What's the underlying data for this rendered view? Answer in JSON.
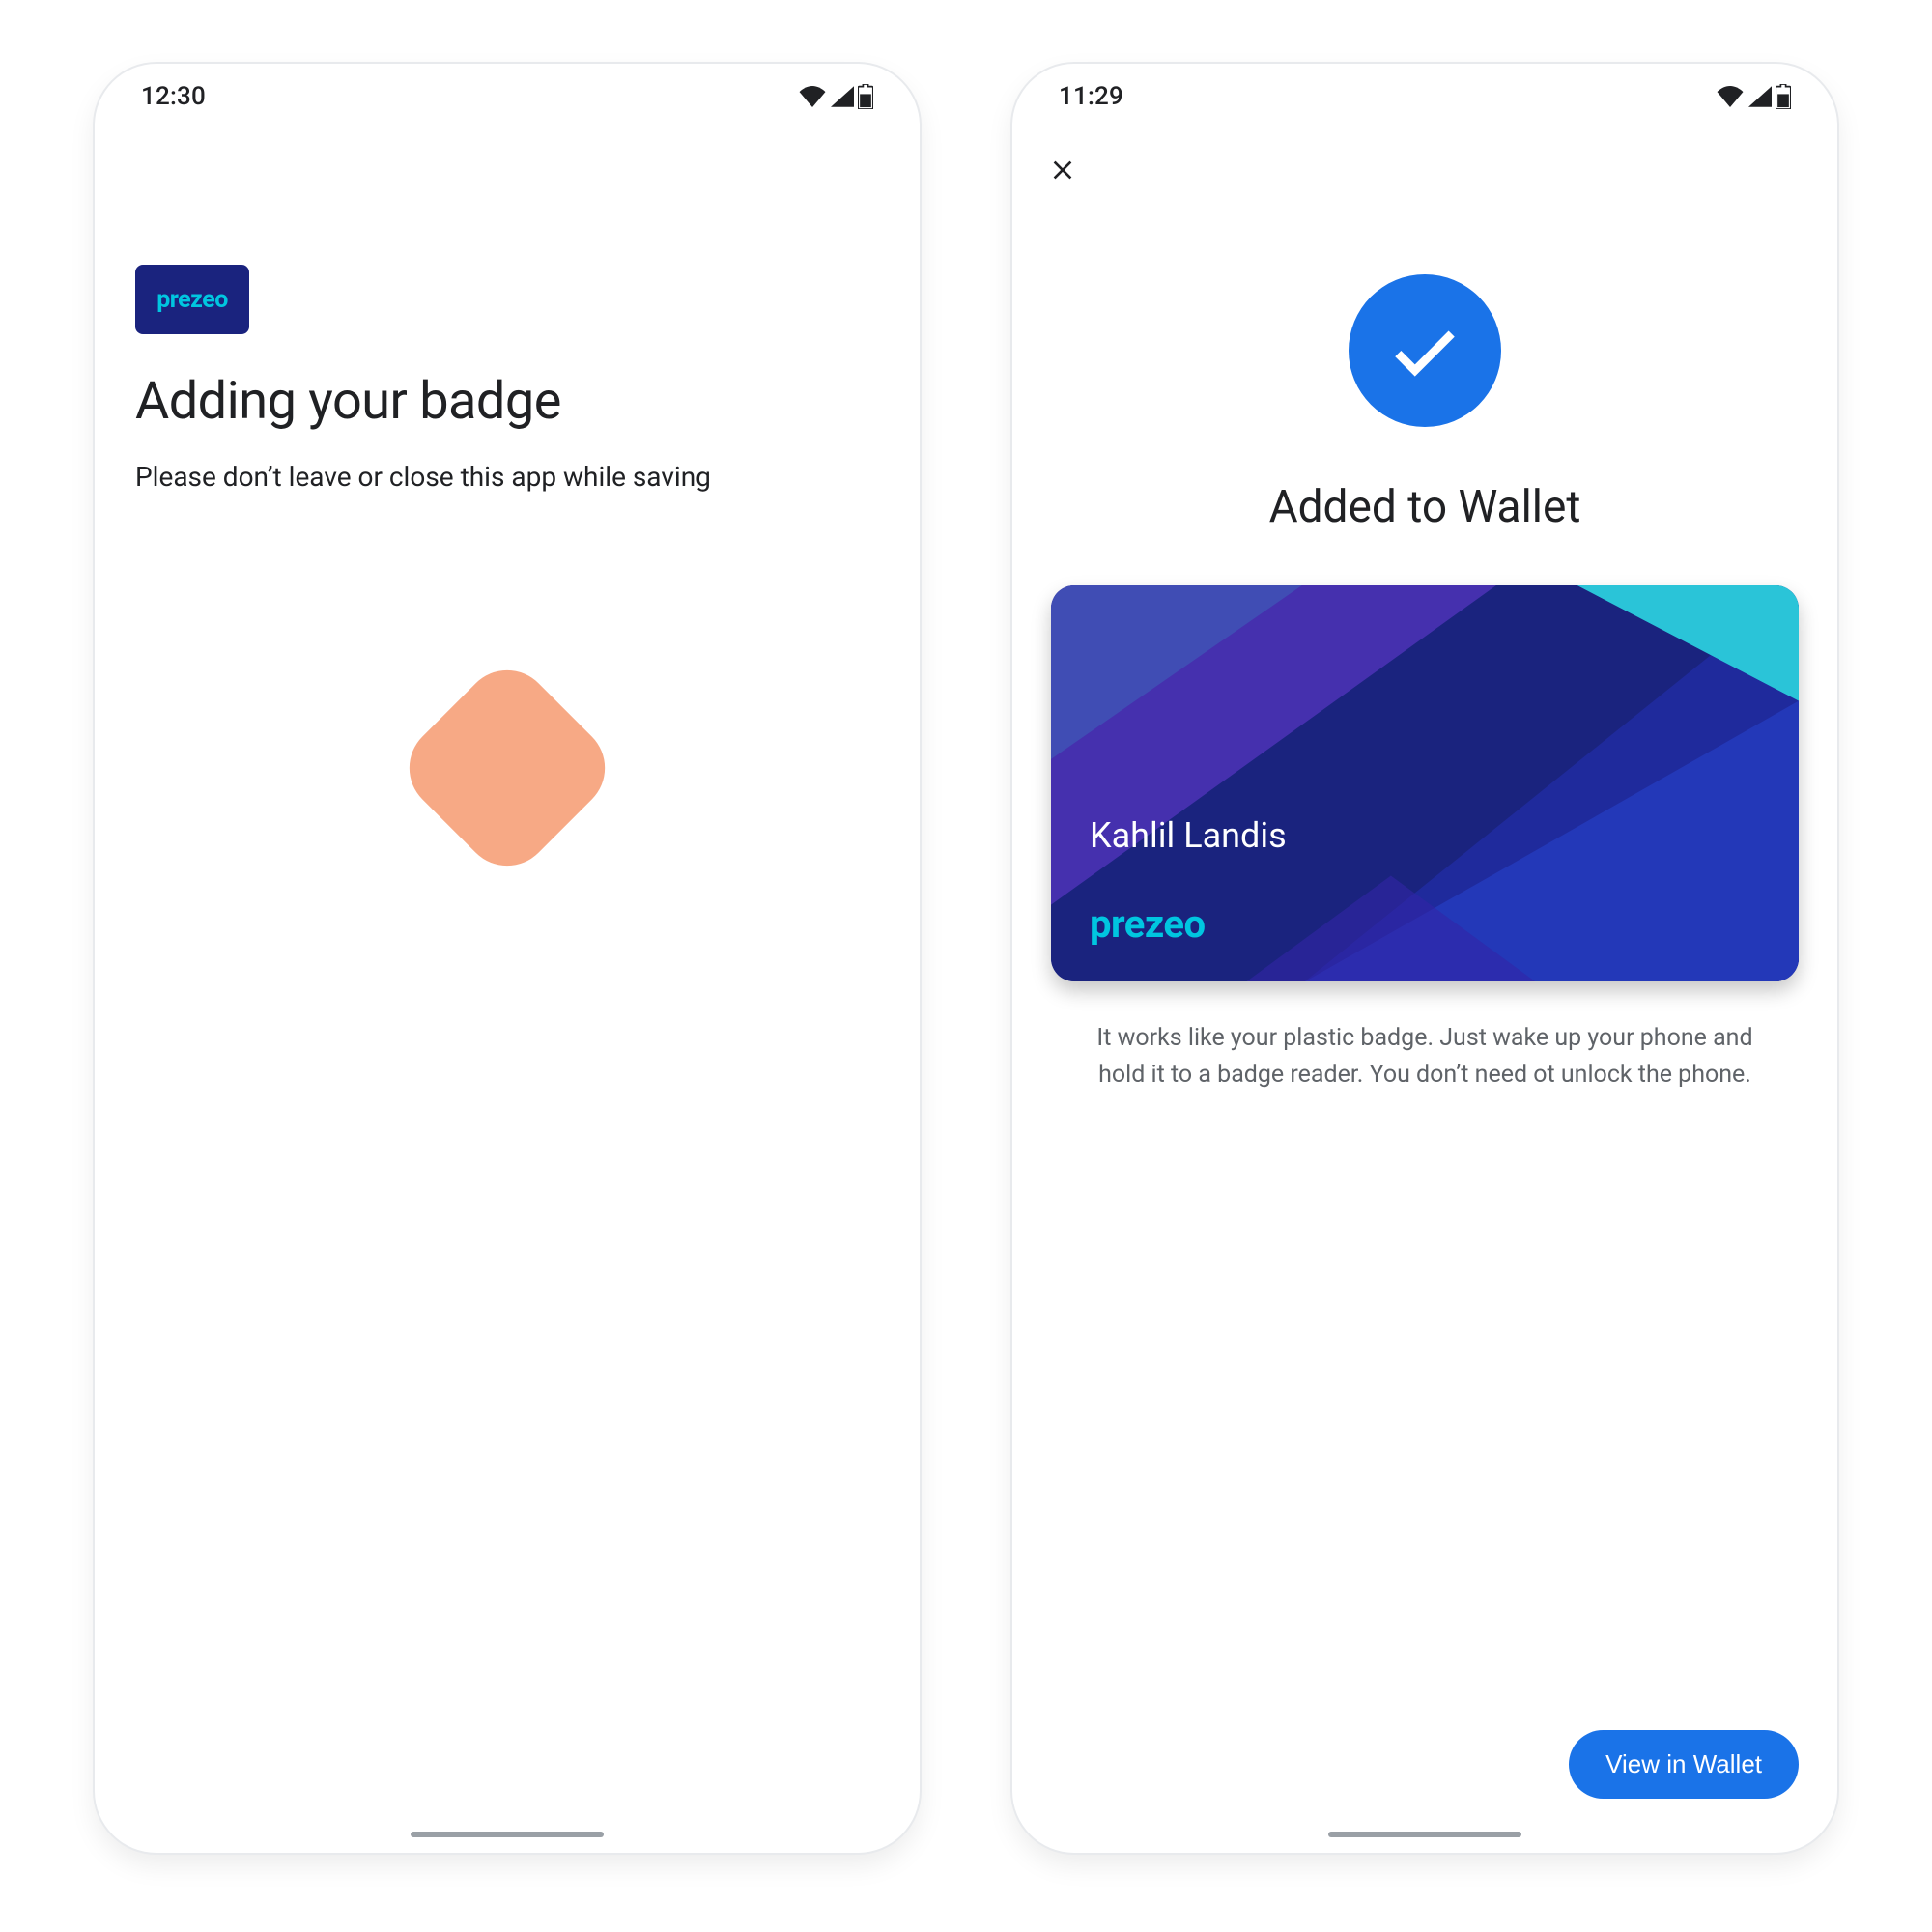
{
  "screen1": {
    "statusbar": {
      "time": "12:30"
    },
    "brand_chip": "prezeo",
    "title": "Adding your badge",
    "subtitle": "Please don’t leave or close this app while saving"
  },
  "screen2": {
    "statusbar": {
      "time": "11:29"
    },
    "title": "Added to Wallet",
    "card": {
      "holder_name": "Kahlil Landis",
      "brand": "prezeo"
    },
    "description": "It works like your plastic badge. Just wake up your phone and hold it to a badge reader. You don’t need ot unlock the phone.",
    "cta_label": "View in Wallet"
  },
  "colors": {
    "google_blue": "#1a73e8",
    "brand_navy": "#1a237e",
    "brand_cyan": "#00c6e0",
    "peach": "#f7a985"
  }
}
